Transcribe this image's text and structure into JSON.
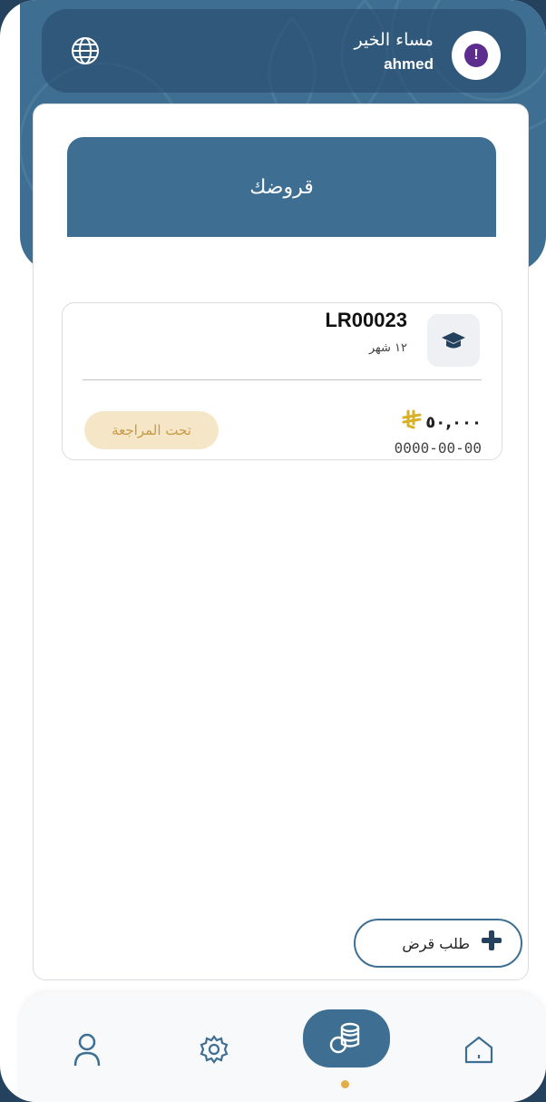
{
  "header": {
    "greeting": "مساء الخير",
    "username": "ahmed",
    "avatar_icon": "alert-icon",
    "avatar_glyph": "!",
    "language_icon": "globe-icon"
  },
  "page": {
    "title": "قروضك"
  },
  "loans": [
    {
      "id": "LR00023",
      "term": "١٢ شهر",
      "amount": "٥٠,٠٠٠",
      "currency_icon": "riyal-icon",
      "date": "0000-00-00",
      "status": "تحت المراجعة",
      "icon": "graduation-cap-icon"
    }
  ],
  "actions": {
    "request_loan_label": "طلب قرض"
  },
  "nav": {
    "items": [
      "profile-icon",
      "settings-icon",
      "loans-icon",
      "home-icon"
    ],
    "active": "loans-icon"
  },
  "colors": {
    "primary": "#3e6f93",
    "dark": "#24415e",
    "accent": "#e3ae48",
    "status_bg": "#f6e6c8",
    "status_text": "#c89a45"
  }
}
